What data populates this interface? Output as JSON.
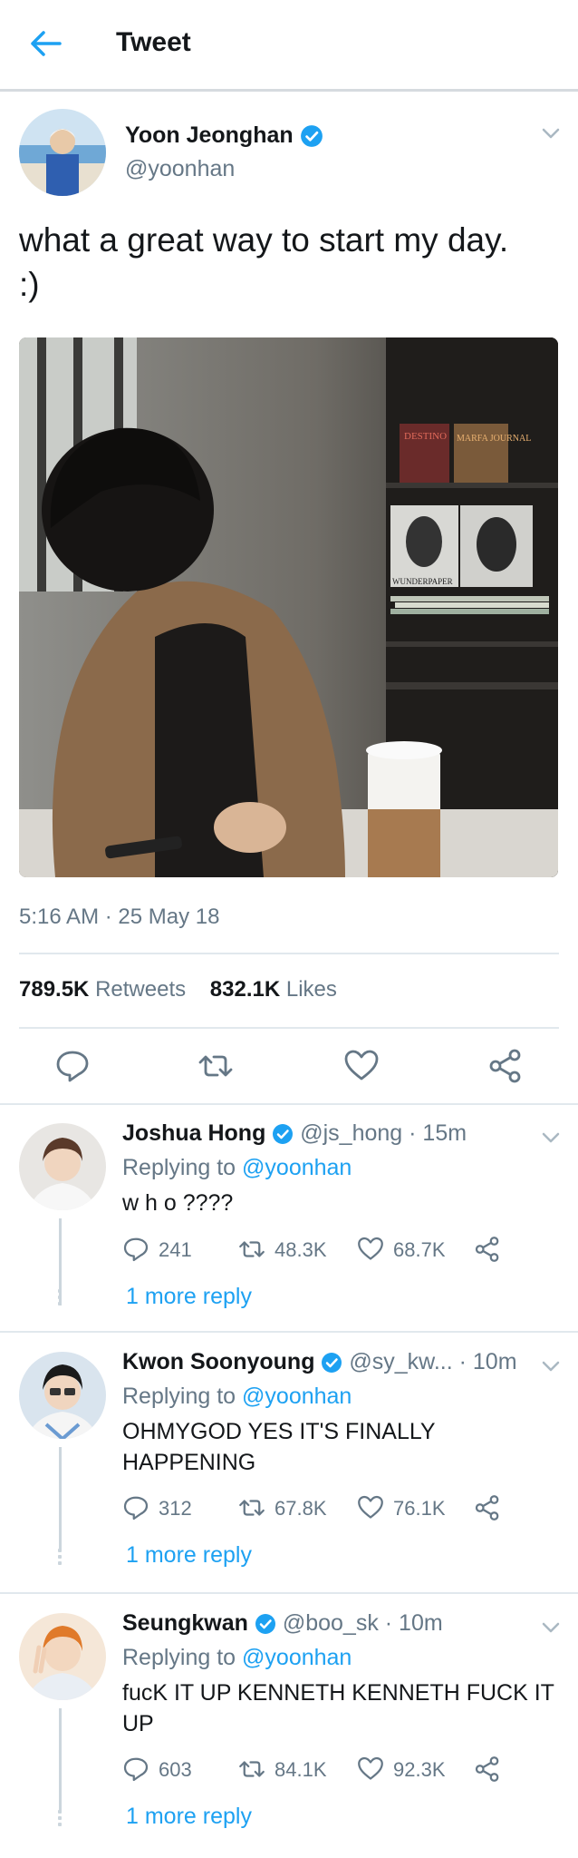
{
  "header": {
    "title": "Tweet"
  },
  "tweet": {
    "name": "Yoon Jeonghan",
    "handle": "@yoonhan",
    "text": "what a great way to start my day. :)",
    "timestamp": "5:16 AM · 25 May 18",
    "retweets_count": "789.5K",
    "retweets_label": "Retweets",
    "likes_count": "832.1K",
    "likes_label": "Likes"
  },
  "replies": [
    {
      "name": "Joshua Hong",
      "handle": "@js_hong",
      "time": "· 15m",
      "replying_prefix": "Replying to",
      "replying_to": "@yoonhan",
      "text": "w h o ????",
      "reply_count": "241",
      "retweet_count": "48.3K",
      "like_count": "68.7K",
      "more_label": "1 more reply"
    },
    {
      "name": "Kwon Soonyoung",
      "handle": "@sy_kw...",
      "time": "· 10m",
      "replying_prefix": "Replying to",
      "replying_to": "@yoonhan",
      "text": "OHMYGOD YES IT'S FINALLY HAPPENING",
      "reply_count": "312",
      "retweet_count": "67.8K",
      "like_count": "76.1K",
      "more_label": "1 more reply"
    },
    {
      "name": "Seungkwan",
      "handle": "@boo_sk",
      "time": "· 10m",
      "replying_prefix": "Replying to",
      "replying_to": "@yoonhan",
      "text": "fucK IT UP KENNETH KENNETH FUCK IT UP",
      "reply_count": "603",
      "retweet_count": "84.1K",
      "like_count": "92.3K",
      "more_label": "1 more reply"
    }
  ],
  "photo_magazines": [
    "DESTINO",
    "MARFA JOURNAL",
    "WUNDERPAPER"
  ],
  "colors": {
    "accent": "#1da1f2",
    "muted": "#657786",
    "text": "#14171a",
    "divider": "#e1e8ed"
  },
  "icons": [
    "back-arrow-icon",
    "verified-badge-icon",
    "chevron-down-icon",
    "reply-icon",
    "retweet-icon",
    "like-icon",
    "share-icon"
  ]
}
